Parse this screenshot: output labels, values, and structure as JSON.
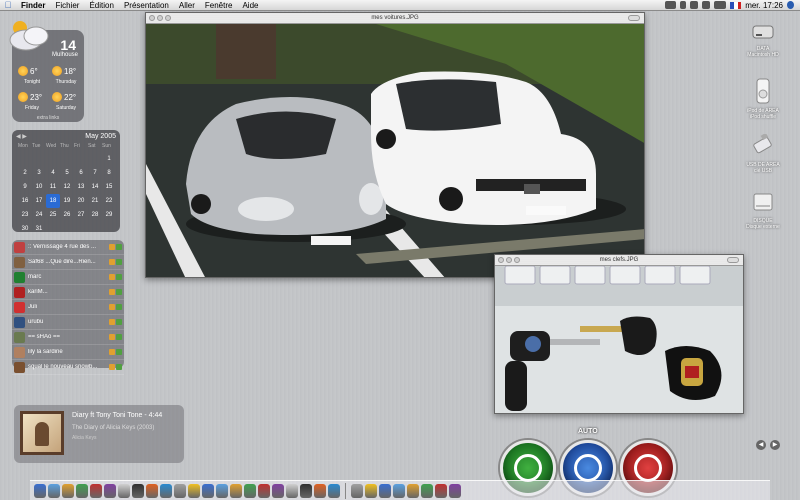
{
  "menubar": {
    "apple_icon": "apple-icon",
    "menus": [
      "Finder",
      "Fichier",
      "Édition",
      "Présentation",
      "Aller",
      "Fenêtre",
      "Aide"
    ],
    "clock": "mer. 17:26"
  },
  "weather": {
    "temperature": "14",
    "city": "Mulhouse",
    "forecast": [
      {
        "deg": "6°",
        "day": "Tonight"
      },
      {
        "deg": "18°",
        "day": "Thursday"
      },
      {
        "deg": "23°",
        "day": "Friday"
      },
      {
        "deg": "22°",
        "day": "Saturday"
      }
    ],
    "links": "extra links"
  },
  "calendar": {
    "month": "May 2005",
    "weekdays": [
      "Mon",
      "Tue",
      "Wed",
      "Thu",
      "Fri",
      "Sat",
      "Sun"
    ],
    "today": 18,
    "days": [
      "",
      "",
      "",
      "",
      "",
      "",
      "1",
      "2",
      "3",
      "4",
      "5",
      "6",
      "7",
      "8",
      "9",
      "10",
      "11",
      "12",
      "13",
      "14",
      "15",
      "16",
      "17",
      "18",
      "19",
      "20",
      "21",
      "22",
      "23",
      "24",
      "25",
      "26",
      "27",
      "28",
      "29",
      "30",
      "31"
    ]
  },
  "buddies": [
    {
      "name": ":: Vernissage 4 rue des ...",
      "color": "#c04040"
    },
    {
      "name": "Saf68 ...Que dire...Rien...",
      "color": "#806040"
    },
    {
      "name": "marc",
      "color": "#208030"
    },
    {
      "name": "kariM...",
      "color": "#b02020"
    },
    {
      "name": "Juli",
      "color": "#d03030"
    },
    {
      "name": "urubu",
      "color": "#305080"
    },
    {
      "name": "== sHAo ==",
      "color": "#6a7a50"
    },
    {
      "name": "lily la sardine",
      "color": "#b08060"
    },
    {
      "name": "squal le nouveau snowb...",
      "color": "#7a5030"
    }
  ],
  "itunes": {
    "track": "Diary ft Tony Toni Tone - 4:44",
    "album": "The Diary of Alicia Keys (2003)",
    "artist": "Alicia Keys"
  },
  "window_cars": {
    "title": "mes voitures.JPG"
  },
  "window_keys": {
    "title": "mes clefs.JPG"
  },
  "desktop_icons": [
    {
      "label": "DATA",
      "sub": "Macintosh HD"
    },
    {
      "label": "iPod de AREA",
      "sub": "iPod shuffle"
    },
    {
      "label": "USB DE AREA",
      "sub": "clé USB"
    },
    {
      "label": "DISQUE",
      "sub": "Disque externe"
    }
  ],
  "controls": {
    "auto_label": "AUTO"
  },
  "dock": {
    "count": 30
  }
}
